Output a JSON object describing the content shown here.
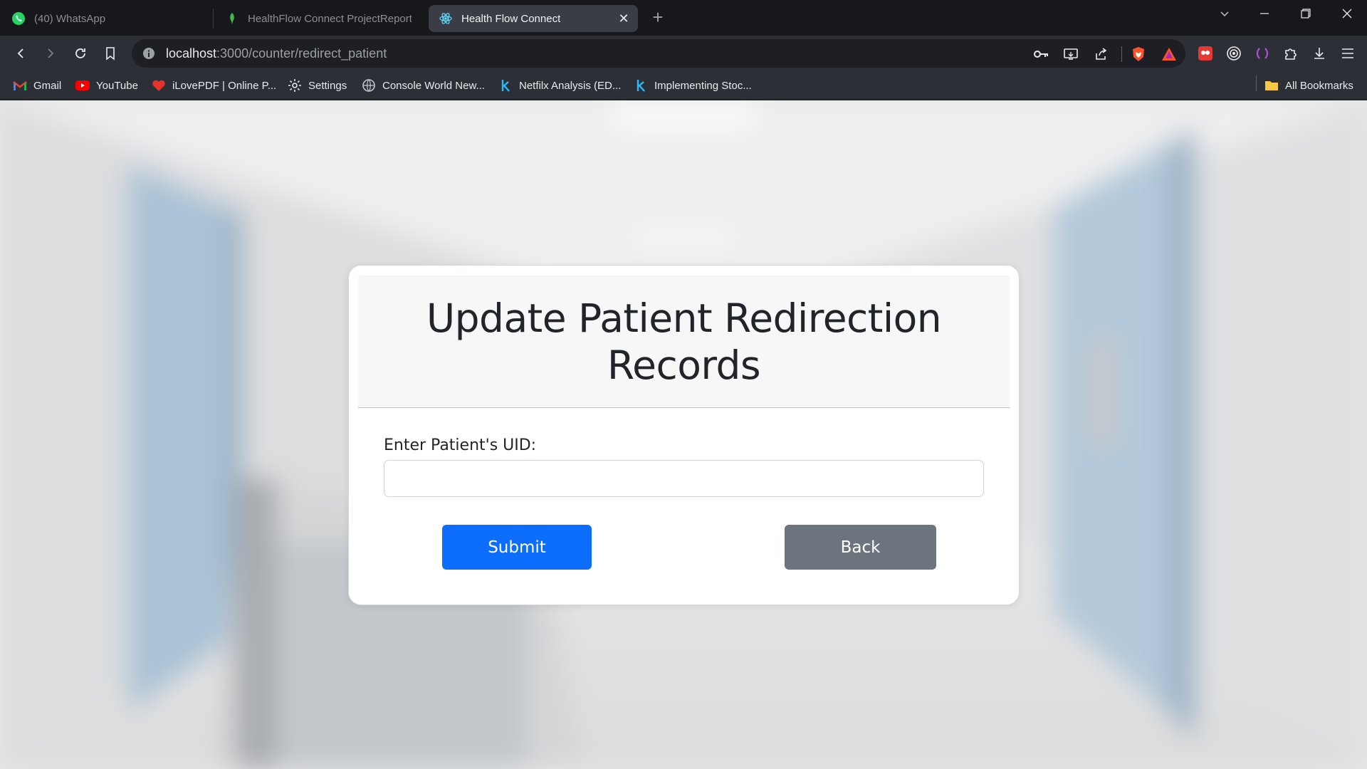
{
  "browser": {
    "tabs": [
      {
        "title": "(40) WhatsApp",
        "icon": "whatsapp-icon",
        "active": false
      },
      {
        "title": "HealthFlow Connect ProjectReport -",
        "icon": "leaf-icon",
        "active": false
      },
      {
        "title": "Health Flow Connect",
        "icon": "react-icon",
        "active": true
      }
    ],
    "url": {
      "host": "localhost",
      "path": ":3000/counter/redirect_patient"
    },
    "bookmarks": [
      {
        "label": "Gmail",
        "icon": "gmail-icon"
      },
      {
        "label": "YouTube",
        "icon": "youtube-icon"
      },
      {
        "label": "iLovePDF | Online P...",
        "icon": "heart-icon"
      },
      {
        "label": "Settings",
        "icon": "gear-icon"
      },
      {
        "label": "Console World New...",
        "icon": "globe-icon"
      },
      {
        "label": "Netfilx Analysis (ED...",
        "icon": "kaggle-icon"
      },
      {
        "label": "Implementing Stoc...",
        "icon": "kaggle-icon"
      }
    ],
    "all_bookmarks": "All Bookmarks"
  },
  "form": {
    "title": "Update Patient Redirection Records",
    "uid_label": "Enter Patient's UID:",
    "uid_value": "",
    "submit_label": "Submit",
    "back_label": "Back"
  },
  "colors": {
    "primary": "#0d6efd",
    "secondary": "#6c757d"
  }
}
